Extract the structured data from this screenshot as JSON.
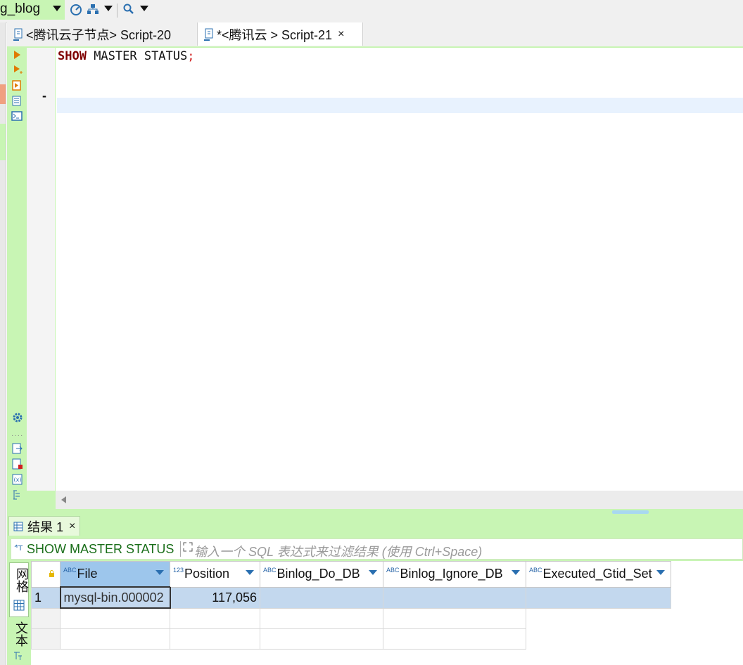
{
  "toolbar": {
    "database": "g_blog"
  },
  "tabs": [
    {
      "label": "<腾讯云子节点> Script-20"
    },
    {
      "label": "*<腾讯云 > Script-21",
      "close": "×"
    }
  ],
  "editor": {
    "kw1": "SHOW",
    "rest": " MASTER STATUS",
    "semi": ";",
    "marker": "-"
  },
  "results": {
    "tab_label": "结果 1",
    "tab_close": "×",
    "query_label": "SHOW MASTER STATUS",
    "filter_placeholder": "输入一个 SQL 表达式来过滤结果 (使用 Ctrl+Space)",
    "side_grid_label": "网格",
    "side_text_label": "文本",
    "columns": [
      {
        "type": "ABC",
        "name": "File"
      },
      {
        "type": "123",
        "name": "Position"
      },
      {
        "type": "ABC",
        "name": "Binlog_Do_DB"
      },
      {
        "type": "ABC",
        "name": "Binlog_Ignore_DB"
      },
      {
        "type": "ABC",
        "name": "Executed_Gtid_Set"
      }
    ],
    "rows": [
      {
        "num": "1",
        "file": "mysql-bin.000002",
        "position": "117,056",
        "do_db": "",
        "ignore_db": "",
        "gtid": ""
      }
    ]
  },
  "colors": {
    "accent_green": "#c8f5b4",
    "selection_blue": "#c3d8ee",
    "keyword": "#7f0000"
  }
}
